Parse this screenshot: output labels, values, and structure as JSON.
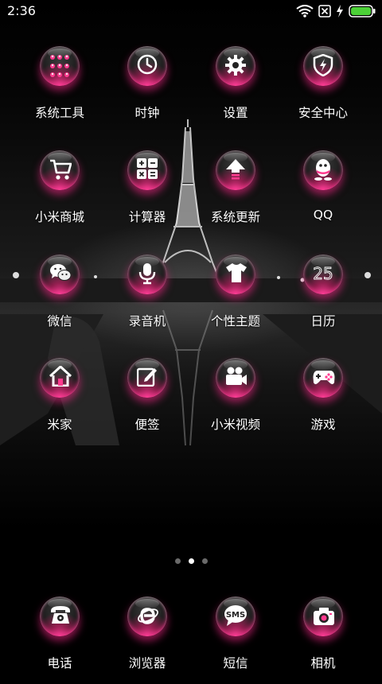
{
  "status_bar": {
    "time": "2:36",
    "icons": [
      "wifi-icon",
      "sim-off-icon",
      "charging-icon",
      "battery-icon"
    ],
    "battery_color": "#4cd137"
  },
  "accent_color": "#ff2d8c",
  "apps": [
    {
      "label": "系统工具",
      "icon": "folder-grid-icon"
    },
    {
      "label": "时钟",
      "icon": "clock-icon"
    },
    {
      "label": "设置",
      "icon": "gear-icon"
    },
    {
      "label": "安全中心",
      "icon": "shield-icon"
    },
    {
      "label": "小米商城",
      "icon": "cart-icon"
    },
    {
      "label": "计算器",
      "icon": "calculator-icon"
    },
    {
      "label": "系统更新",
      "icon": "arrow-up-icon"
    },
    {
      "label": "QQ",
      "icon": "penguin-icon"
    },
    {
      "label": "微信",
      "icon": "chat-icon"
    },
    {
      "label": "录音机",
      "icon": "microphone-icon"
    },
    {
      "label": "个性主题",
      "icon": "tshirt-icon"
    },
    {
      "label": "日历",
      "icon": "calendar-icon",
      "badge": "25"
    },
    {
      "label": "米家",
      "icon": "home-icon"
    },
    {
      "label": "便签",
      "icon": "note-icon"
    },
    {
      "label": "小米视频",
      "icon": "video-camera-icon"
    },
    {
      "label": "游戏",
      "icon": "gamepad-icon"
    }
  ],
  "pager": {
    "count": 3,
    "active": 2
  },
  "dock": [
    {
      "label": "电话",
      "icon": "phone-icon"
    },
    {
      "label": "浏览器",
      "icon": "browser-icon"
    },
    {
      "label": "短信",
      "icon": "sms-icon",
      "badge": "SMS"
    },
    {
      "label": "相机",
      "icon": "camera-icon"
    }
  ]
}
